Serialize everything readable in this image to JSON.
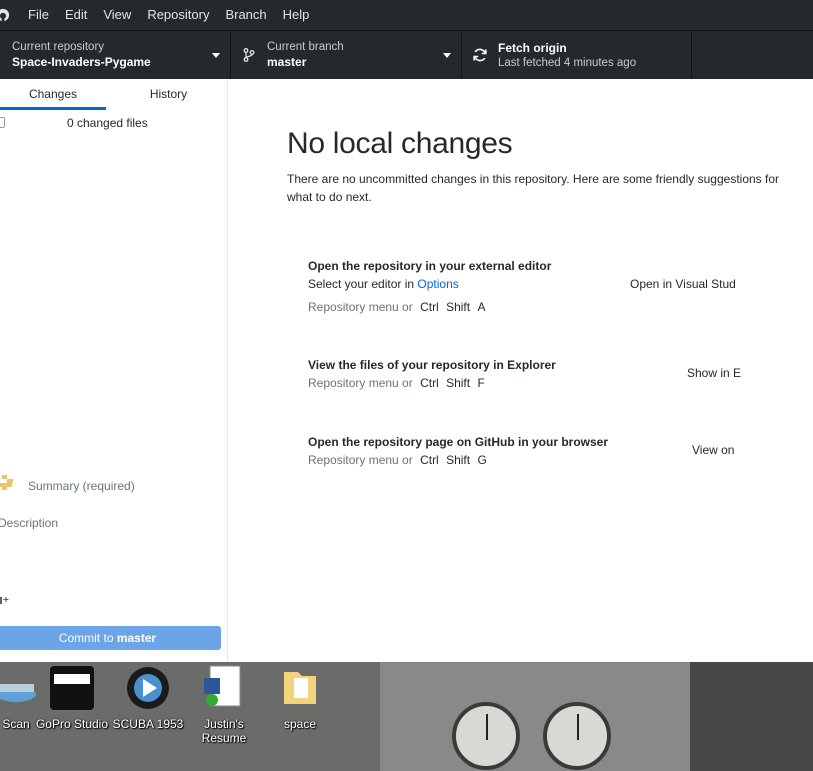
{
  "menubar": {
    "items": [
      "File",
      "Edit",
      "View",
      "Repository",
      "Branch",
      "Help"
    ]
  },
  "toolbar": {
    "repo_label": "Current repository",
    "repo_value": "Space-Invaders-Pygame",
    "branch_label": "Current branch",
    "branch_value": "master",
    "fetch_label": "Fetch origin",
    "fetch_status": "Last fetched 4 minutes ago"
  },
  "sidebar": {
    "tabs": [
      "Changes",
      "History"
    ],
    "changed_files": "0 changed files",
    "summary_placeholder": "Summary (required)",
    "description_placeholder": "Description",
    "coauthor_label": "+",
    "commit_button_prefix": "Commit to ",
    "commit_button_branch": "master"
  },
  "main": {
    "title": "No local changes",
    "description": "There are no uncommitted changes in this repository. Here are some friendly suggestions for what to do next.",
    "actions": [
      {
        "title": "Open the repository in your external editor",
        "sub_prefix": "Select your editor in ",
        "sub_link": "Options",
        "kbd_prefix": "Repository menu or",
        "keys": [
          "Ctrl",
          "Shift",
          "A"
        ],
        "button": "Open in Visual Stud"
      },
      {
        "title": "View the files of your repository in Explorer",
        "kbd_prefix": "Repository menu or",
        "keys": [
          "Ctrl",
          "Shift",
          "F"
        ],
        "button": "Show in E"
      },
      {
        "title": "Open the repository page on GitHub in your browser",
        "kbd_prefix": "Repository menu or",
        "keys": [
          "Ctrl",
          "Shift",
          "G"
        ],
        "button": "View on"
      }
    ]
  },
  "desktop": {
    "icons": [
      "Scan",
      "GoPro Studio",
      "SCUBA 1953",
      "Justin's Resume",
      "space"
    ]
  }
}
